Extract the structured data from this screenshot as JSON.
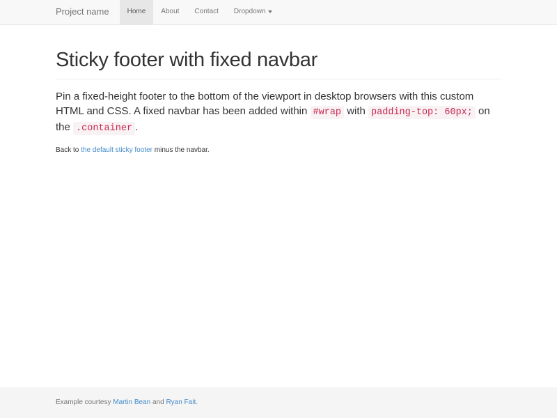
{
  "navbar": {
    "brand": "Project name",
    "items": [
      {
        "label": "Home",
        "active": true
      },
      {
        "label": "About",
        "active": false
      },
      {
        "label": "Contact",
        "active": false
      },
      {
        "label": "Dropdown",
        "active": false,
        "dropdown": true
      }
    ]
  },
  "page": {
    "title": "Sticky footer with fixed navbar",
    "lead_p1": "Pin a fixed-height footer to the bottom of the viewport in desktop browsers with this custom HTML and CSS. A fixed navbar has been added within ",
    "code1": "#wrap",
    "lead_p2": " with ",
    "code2": "padding-top: 60px;",
    "lead_p3": " on the ",
    "code3": ".container",
    "lead_p4": ".",
    "back_prefix": "Back to ",
    "back_link": "the default sticky footer",
    "back_suffix": " minus the navbar."
  },
  "footer": {
    "prefix": "Example courtesy ",
    "link1": "Martin Bean",
    "mid": " and ",
    "link2": "Ryan Fait",
    "suffix": "."
  }
}
